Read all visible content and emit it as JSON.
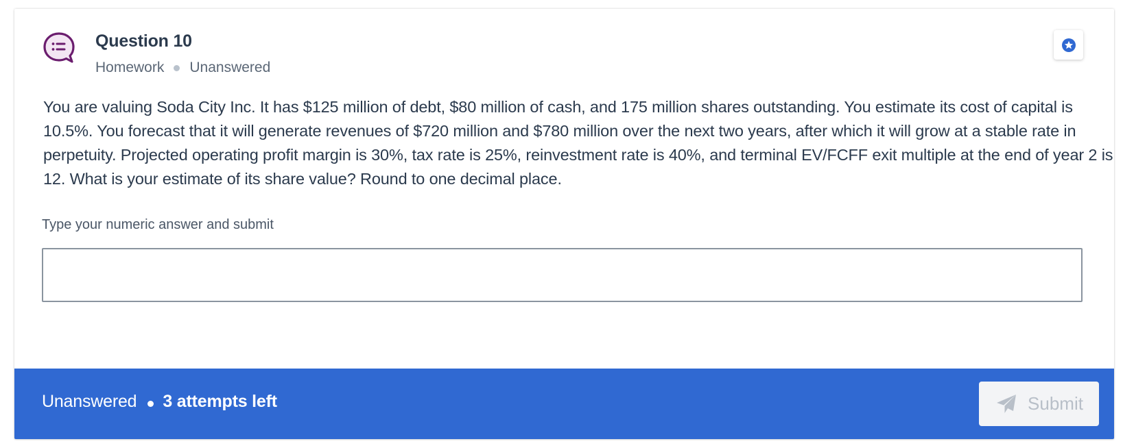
{
  "question": {
    "title": "Question 10",
    "category": "Homework",
    "status": "Unanswered",
    "text": "You are valuing Soda City Inc. It has $125 million of debt, $80 million of cash, and 175 million shares outstanding. You estimate its cost of capital is 10.5%. You forecast that it will generate revenues of $720 million and $780 million over the next two years, after which it will grow at a stable rate in perpetuity. Projected operating profit margin is 30%, tax rate is 25%, reinvestment rate is 40%, and terminal EV/FCFF exit multiple at the end of year 2 is 12. What is your estimate of its share value? Round to one decimal place."
  },
  "answer": {
    "label": "Type your numeric answer and submit",
    "value": "",
    "placeholder": ""
  },
  "footer": {
    "status": "Unanswered",
    "attempts": "3 attempts left",
    "submit_label": "Submit"
  },
  "icons": {
    "question": "chat-list-icon",
    "bookmark": "star-badge-icon",
    "submit": "paper-plane-icon"
  },
  "colors": {
    "accent": "#3069d2",
    "icon_purple": "#6b1d6e",
    "icon_bg": "#f3e6f3",
    "text_dark": "#2b3a4d",
    "text_muted": "#5b6776"
  }
}
